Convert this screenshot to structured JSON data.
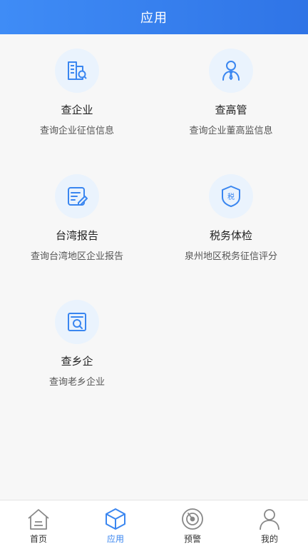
{
  "header": {
    "title": "应用"
  },
  "apps": [
    {
      "name": "查企业",
      "desc": "查询企业征信信息",
      "icon": "building-search-icon"
    },
    {
      "name": "查高管",
      "desc": "查询企业董高监信息",
      "icon": "executive-person-icon"
    },
    {
      "name": "台湾报告",
      "desc": "查询台湾地区企业报告",
      "icon": "report-edit-icon"
    },
    {
      "name": "税务体检",
      "desc": "泉州地区税务征信评分",
      "icon": "tax-shield-icon"
    },
    {
      "name": "查乡企",
      "desc": "查询老乡企业",
      "icon": "document-search-icon"
    }
  ],
  "tabbar": {
    "active": "应用",
    "accent_color": "#3a86f0",
    "tabs": [
      {
        "label": "首页",
        "icon": "home-icon"
      },
      {
        "label": "应用",
        "icon": "cube-icon"
      },
      {
        "label": "预警",
        "icon": "radar-icon"
      },
      {
        "label": "我的",
        "icon": "user-icon"
      }
    ]
  }
}
